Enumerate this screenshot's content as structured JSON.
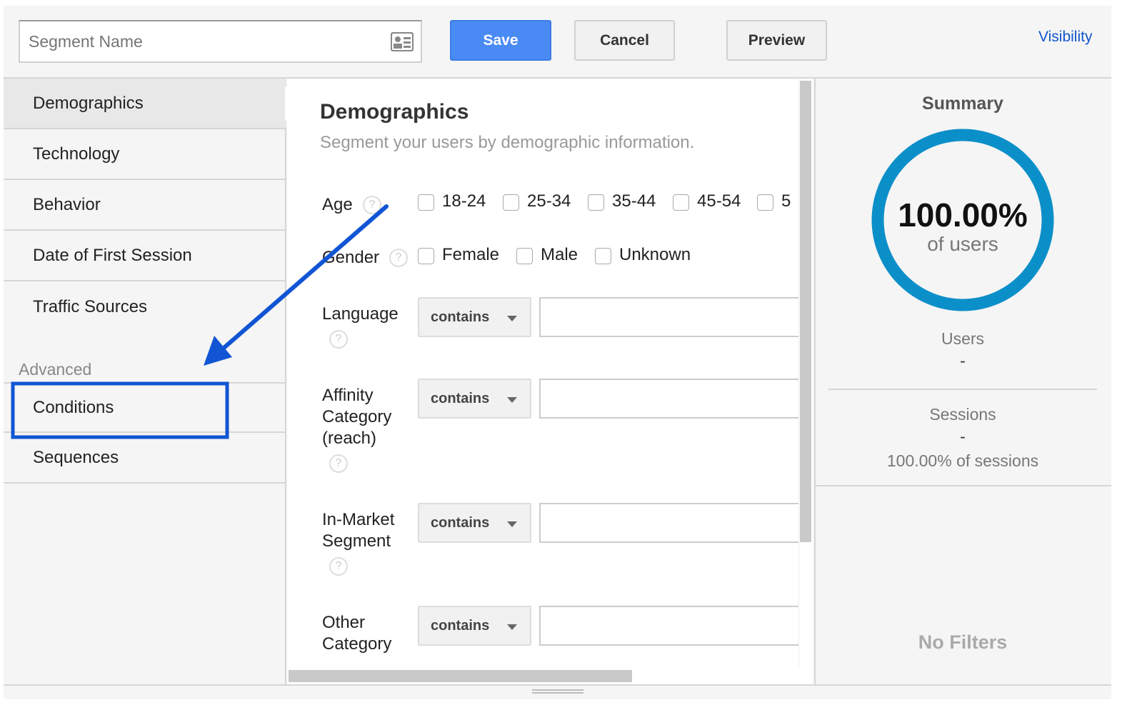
{
  "header": {
    "segment_name_placeholder": "Segment Name",
    "save": "Save",
    "cancel": "Cancel",
    "preview": "Preview",
    "visibility": "Visibility"
  },
  "sidebar": {
    "items": [
      {
        "label": "Demographics",
        "selected": true
      },
      {
        "label": "Technology"
      },
      {
        "label": "Behavior"
      },
      {
        "label": "Date of First Session"
      },
      {
        "label": "Traffic Sources"
      }
    ],
    "advanced_label": "Advanced",
    "advanced_items": [
      {
        "label": "Conditions",
        "highlighted": true
      },
      {
        "label": "Sequences"
      }
    ]
  },
  "main": {
    "title": "Demographics",
    "subtitle": "Segment your users by demographic information.",
    "age": {
      "label": "Age",
      "options": [
        "18-24",
        "25-34",
        "35-44",
        "45-54",
        "5"
      ]
    },
    "gender": {
      "label": "Gender",
      "options": [
        "Female",
        "Male",
        "Unknown"
      ]
    },
    "help": "?",
    "filters": [
      {
        "label": [
          "Language"
        ],
        "operator": "contains",
        "value": ""
      },
      {
        "label": [
          "Affinity",
          "Category",
          "(reach)"
        ],
        "operator": "contains",
        "value": ""
      },
      {
        "label": [
          "In-Market",
          "Segment"
        ],
        "operator": "contains",
        "value": ""
      },
      {
        "label": [
          "Other",
          "Category"
        ],
        "operator": "contains",
        "value": ""
      }
    ]
  },
  "summary": {
    "title": "Summary",
    "percent": "100.00%",
    "percent_caption": "of users",
    "users_label": "Users",
    "users_value": "-",
    "sessions_label": "Sessions",
    "sessions_value": "-",
    "sessions_caption": "100.00% of sessions",
    "no_filters": "No Filters",
    "ring_fill": 1.0,
    "ring_color": "#0b8fc9"
  },
  "annotation": {
    "color": "#1155d4",
    "target": "Conditions"
  }
}
